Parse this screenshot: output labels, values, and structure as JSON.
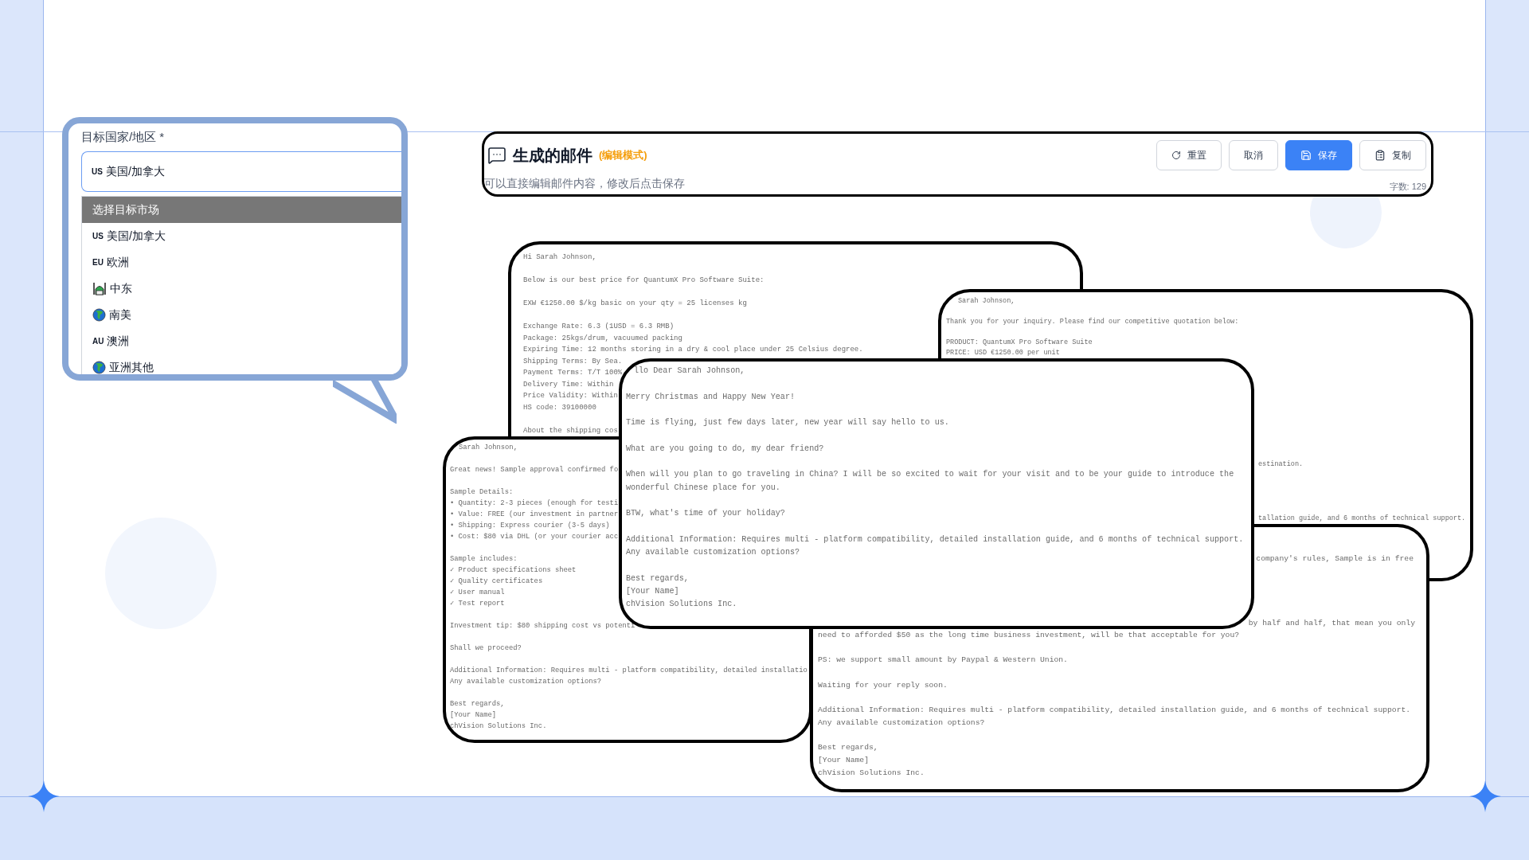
{
  "market_field": {
    "label": "目标国家/地区 *",
    "code": "US",
    "value": "美国/加拿大"
  },
  "market_options": [
    {
      "kind": "plain",
      "label": "选择目标市场",
      "selected": true
    },
    {
      "kind": "code",
      "code": "US",
      "label": "美国/加拿大",
      "selected": false
    },
    {
      "kind": "code",
      "code": "EU",
      "label": "欧洲",
      "selected": false
    },
    {
      "kind": "landmark",
      "label": "中东",
      "selected": false
    },
    {
      "kind": "globe",
      "label": "南美",
      "selected": false
    },
    {
      "kind": "code",
      "code": "AU",
      "label": "澳洲",
      "selected": false
    },
    {
      "kind": "globe",
      "label": "亚洲其他",
      "selected": false
    }
  ],
  "email_panel": {
    "title": "生成的邮件",
    "mode": "(编辑模式)",
    "hint": "可以直接编辑邮件内容，修改后点击保存",
    "word_count": "字数: 129",
    "buttons": [
      {
        "kind": "reset",
        "label": "重置",
        "primary": false
      },
      {
        "kind": "cancel",
        "label": "取消",
        "primary": false
      },
      {
        "kind": "save",
        "label": "保存",
        "primary": true
      },
      {
        "kind": "copy",
        "label": "复制",
        "primary": false
      }
    ]
  },
  "email_cards": [
    {
      "paragraphs": [
        [
          "Hi Sarah Johnson,"
        ],
        [
          "Below is our best price for QuantumX Pro Software Suite:"
        ],
        [
          "EXW €1250.00 $/kg basic on your qty = 25 licenses kg"
        ],
        [
          "Exchange Rate: 6.3 (1USD = 6.3 RMB)",
          "Package: 25kgs/drum, vacuumed packing",
          "Expiring Time: 12 months storing in a dry & cool place under 25 Celsius degree.",
          "Shipping Terms: By Sea.",
          "Payment Terms: T/T 100%",
          "Delivery Time: Within",
          "Price Validity: Within",
          "HS code: 39100000"
        ],
        [
          "About the shipping cos"
        ]
      ]
    },
    {
      "paragraphs": [
        [
          "Sarah Johnson,"
        ],
        [
          "Thank you for your inquiry. Please find our competitive quotation below:"
        ],
        [
          "PRODUCT: QuantumX Pro Software Suite",
          "PRICE: USD €1250.00 per unit"
        ]
      ],
      "fragments": [
        "estination.",
        "tallation guide, and 6 months of technical support."
      ]
    },
    {
      "paragraphs": [
        [
          "Sarah Johnson,"
        ],
        [
          "Great news! Sample approval confirmed fo"
        ],
        [
          "Sample Details:",
          "• Quantity: 2-3 pieces (enough for testi",
          "• Value: FREE (our investment in partner",
          "• Shipping: Express courier (3-5 days)",
          "• Cost: $80 via DHL (or your courier acc"
        ],
        [
          "Sample includes:",
          "✓ Product specifications sheet",
          "✓ Quality certificates",
          "✓ User manual",
          "✓ Test report"
        ],
        [
          "Investment tip: $80 shipping cost vs potenti"
        ],
        [
          "Shall we proceed?"
        ],
        [
          "Additional Information: Requires multi - platform compatibility, detailed installatio",
          "Any available customization options?"
        ],
        [
          "Best regards,",
          "[Your Name]",
          "chVision Solutions Inc."
        ]
      ]
    },
    {
      "paragraphs": [
        [
          "need to afforded $50 as the long time business investment, will be that acceptable for you?"
        ],
        [
          "PS: we support small amount by Paypal & Western Union."
        ],
        [
          "Waiting for your reply soon."
        ],
        [
          "Additional Information: Requires multi - platform compatibility, detailed installation guide, and 6 months of technical support.",
          "Any available customization options?"
        ],
        [
          "Best regards,",
          "[Your Name]",
          "chVision Solutions Inc."
        ]
      ],
      "fragments": [
        "company's rules, Sample is in free",
        "by half and half, that mean you only"
      ]
    },
    {
      "paragraphs": [
        [
          "llo Dear Sarah Johnson,"
        ],
        [
          "Merry Christmas and Happy New Year!"
        ],
        [
          "Time is flying, just few days later, new year will say hello to us."
        ],
        [
          "What are you going to do, my dear friend?"
        ],
        [
          "When will you plan to go traveling in China? I will be so excited to wait for your visit and to be your guide to introduce the",
          "wonderful Chinese place for you."
        ],
        [
          "BTW, what's time of your holiday?"
        ],
        [
          "Additional Information: Requires multi - platform compatibility, detailed installation guide, and 6 months of technical support.",
          "Any available customization options?"
        ],
        [
          "Best regards,",
          "[Your Name]",
          "chVision Solutions Inc."
        ]
      ]
    }
  ]
}
